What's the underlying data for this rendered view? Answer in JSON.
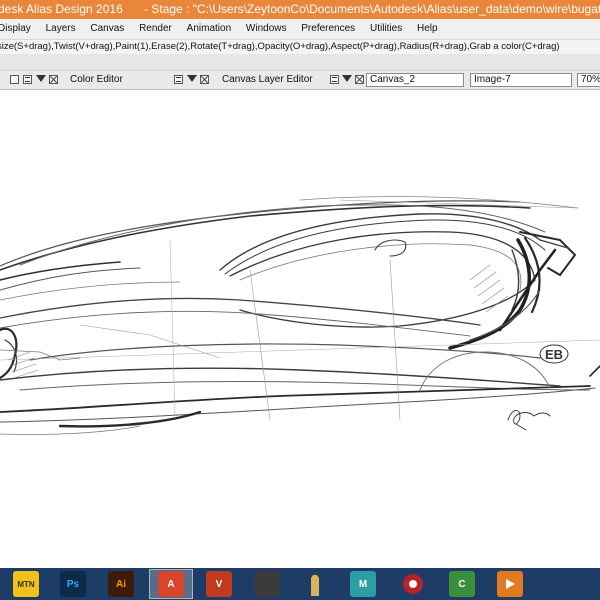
{
  "window": {
    "app_title": "desk Alias Design 2016",
    "stage_title": "- Stage : \"C:\\Users\\ZeytoonCo\\Documents\\Autodesk\\Alias\\user_data\\demo\\wire\\bugatti.w"
  },
  "menu": [
    "Display",
    "Layers",
    "Canvas",
    "Render",
    "Animation",
    "Windows",
    "Preferences",
    "Utilities",
    "Help"
  ],
  "hint": "size(S+drag),Twist(V+drag),Paint(1),Erase(2),Rotate(T+drag),Opacity(O+drag),Aspect(P+drag),Radius(R+drag),Grab a color(C+drag)",
  "panels": {
    "color_editor": "Color Editor",
    "canvas_layer_editor": "Canvas Layer Editor",
    "canvas_field": "Canvas_2",
    "image_field": "Image-7",
    "zoom": "70%"
  },
  "sketch": {
    "logo": "EB",
    "subject": "car-sketch"
  },
  "taskbar": {
    "apps": [
      {
        "name": "mtn-app",
        "label": "MTN",
        "color": "#f2c21a"
      },
      {
        "name": "photoshop",
        "label": "Ps",
        "color": "#0d2a4a"
      },
      {
        "name": "illustrator",
        "label": "Ai",
        "color": "#3d1a0a"
      },
      {
        "name": "autodesk-alias",
        "label": "A",
        "color": "#d8452b"
      },
      {
        "name": "vectorworks",
        "label": "V",
        "color": "#c23a1e"
      },
      {
        "name": "face-app",
        "label": "",
        "color": "#3b3b3b"
      },
      {
        "name": "pencil-app",
        "label": "",
        "color": "#7a6b43"
      },
      {
        "name": "maya",
        "label": "M",
        "color": "#2aa0a4"
      },
      {
        "name": "keyshot",
        "label": "",
        "color": "#b8232a"
      },
      {
        "name": "camtasia",
        "label": "C",
        "color": "#3a8f3a"
      },
      {
        "name": "media-player",
        "label": "",
        "color": "#e27a1f"
      }
    ]
  }
}
